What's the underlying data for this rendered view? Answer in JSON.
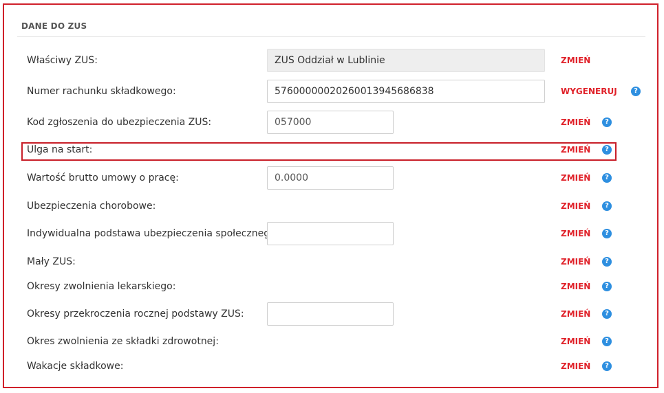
{
  "section": {
    "title": "DANE DO ZUS"
  },
  "rows": [
    {
      "label": "Właściwy ZUS:",
      "value": "ZUS Oddział w Lublinie",
      "action": "ZMIEŃ"
    },
    {
      "label": "Numer rachunku składkowego:",
      "value": "57600000020260013945686838",
      "action": "WYGENERUJ",
      "help": "?"
    },
    {
      "label": "Kod zgłoszenia do ubezpieczenia ZUS:",
      "value": "057000",
      "action": "ZMIEŃ",
      "help": "?"
    },
    {
      "label": "Ulga na start:",
      "action": "ZMIEŃ",
      "help": "?"
    },
    {
      "label": "Wartość brutto umowy o pracę:",
      "value": "0.0000",
      "action": "ZMIEŃ",
      "help": "?"
    },
    {
      "label": "Ubezpieczenia chorobowe:",
      "action": "ZMIEŃ",
      "help": "?"
    },
    {
      "label": "Indywidualna podstawa ubezpieczenia społecznego:",
      "value": "",
      "action": "ZMIEŃ",
      "help": "?"
    },
    {
      "label": "Mały ZUS:",
      "action": "ZMIEŃ",
      "help": "?"
    },
    {
      "label": "Okresy zwolnienia lekarskiego:",
      "action": "ZMIEŃ",
      "help": "?"
    },
    {
      "label": "Okresy przekroczenia rocznej podstawy ZUS:",
      "value": "",
      "action": "ZMIEŃ",
      "help": "?"
    },
    {
      "label": "Okres zwolnienia ze składki zdrowotnej:",
      "action": "ZMIEŃ",
      "help": "?"
    },
    {
      "label": "Wakacje składkowe:",
      "action": "ZMIEŃ",
      "help": "?"
    }
  ],
  "colors": {
    "accent": "#e0222a",
    "help": "#2e8fe0",
    "frame": "#d0202a"
  },
  "icons": {
    "help": "help-icon"
  }
}
